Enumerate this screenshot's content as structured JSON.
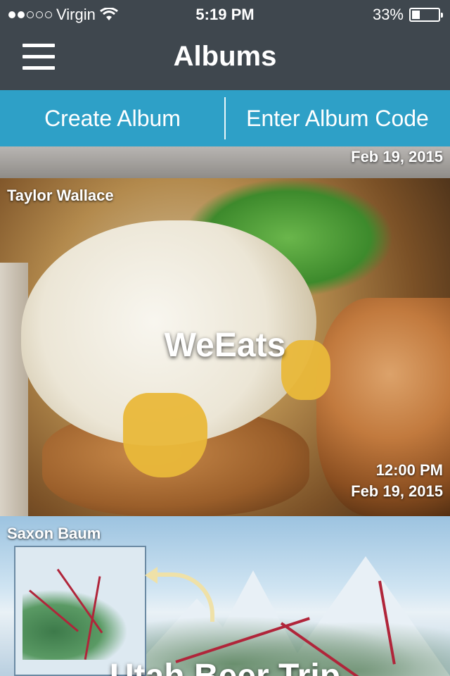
{
  "status_bar": {
    "carrier": "Virgin",
    "time": "5:19 PM",
    "battery": "33%"
  },
  "nav": {
    "title": "Albums"
  },
  "actions": {
    "create_label": "Create Album",
    "enter_code_label": "Enter Album Code"
  },
  "albums": [
    {
      "date": "Feb 19, 2015"
    },
    {
      "owner": "Taylor Wallace",
      "name": "WeEats",
      "time": "12:00 PM",
      "date": "Feb 19, 2015"
    },
    {
      "owner": "Saxon Baum",
      "name": "Utah Beer Trip"
    }
  ],
  "colors": {
    "nav_bg": "#3f474e",
    "action_bar": "#2ea0c7"
  }
}
